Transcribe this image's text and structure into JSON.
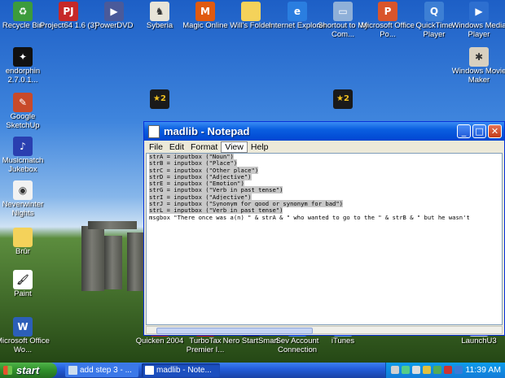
{
  "desktop": {
    "icons": [
      {
        "label": "Recycle Bin",
        "icon": "recycle-bin-icon",
        "color": "#3c9b3c",
        "glyph": "♻"
      },
      {
        "label": "Project64 1.6 (3)",
        "icon": "project64-icon",
        "color": "#c62828",
        "glyph": "PJ"
      },
      {
        "label": "PowerDVD",
        "icon": "powerdvd-icon",
        "color": "#4a5a9a",
        "glyph": "▶"
      },
      {
        "label": "Syberia",
        "icon": "syberia-icon",
        "color": "#e8e4d8",
        "glyph": "♞"
      },
      {
        "label": "Magic Online",
        "icon": "magic-online-icon",
        "color": "#e05a10",
        "glyph": "M"
      },
      {
        "label": "Will's Folder",
        "icon": "folder-icon",
        "color": "#f4d25a",
        "glyph": ""
      },
      {
        "label": "Internet Explorer",
        "icon": "internet-explorer-icon",
        "color": "#2a7ee0",
        "glyph": "e"
      },
      {
        "label": "Shortout to My Com...",
        "icon": "my-computer-icon",
        "color": "#8fb0d8",
        "glyph": "▭"
      },
      {
        "label": "Microsoft Office Po...",
        "icon": "powerpoint-icon",
        "color": "#d9552b",
        "glyph": "P"
      },
      {
        "label": "QuickTime Player",
        "icon": "quicktime-icon",
        "color": "#3d7fd4",
        "glyph": "Q"
      },
      {
        "label": "Windows Media Player",
        "icon": "media-player-icon",
        "color": "#2d6fd0",
        "glyph": "▶"
      },
      {
        "label": "endorphin 2.7.0.1...",
        "icon": "endorphin-icon",
        "color": "#111111",
        "glyph": "✦"
      },
      {
        "label": "Windows Movie Maker",
        "icon": "movie-maker-icon",
        "color": "#d8d0c0",
        "glyph": "✱"
      },
      {
        "label": "Google SketchUp",
        "icon": "sketchup-icon",
        "color": "#c84a2a",
        "glyph": "✎"
      },
      {
        "label": "Musicmatch Jukebox",
        "icon": "musicmatch-icon",
        "color": "#2a3fb0",
        "glyph": "♪"
      },
      {
        "label": "Neverwinter Nights",
        "icon": "neverwinter-icon",
        "color": "#f2f2f2",
        "glyph": "◉"
      },
      {
        "label": "Brûr",
        "icon": "folder-icon",
        "color": "#f4d25a",
        "glyph": ""
      },
      {
        "label": "Paint",
        "icon": "paint-icon",
        "color": "#ffffff",
        "glyph": "🖌"
      },
      {
        "label": "Microsoft Office Wo...",
        "icon": "word-icon",
        "color": "#2c5fb8",
        "glyph": "W"
      },
      {
        "label": "Quicken 2004",
        "icon": "quicken-icon",
        "color": "#b0282a",
        "glyph": "Q"
      },
      {
        "label": "TurboTax Premier I...",
        "icon": "turbotax-icon",
        "color": "#c21c1c",
        "glyph": "T"
      },
      {
        "label": "Nero StartSmart",
        "icon": "nero-icon",
        "color": "#222222",
        "glyph": "N"
      },
      {
        "label": "Sev Account Connection",
        "icon": "account-connection-icon",
        "color": "#4b8bd8",
        "glyph": "S"
      },
      {
        "label": "iTunes",
        "icon": "itunes-icon",
        "color": "#6ea6e0",
        "glyph": "♫"
      },
      {
        "label": "LaunchU3",
        "icon": "launchu3-icon",
        "color": "#d0d8e8",
        "glyph": "U3"
      }
    ],
    "partial_icons": [
      {
        "label": "",
        "icon": "starcraft-icon",
        "color": "#1a1a1a",
        "glyph": "★2"
      },
      {
        "label": "",
        "icon": "starcraft-icon",
        "color": "#1a1a1a",
        "glyph": "★2"
      }
    ]
  },
  "notepad": {
    "title": "madlib - Notepad",
    "menu": [
      "File",
      "Edit",
      "Format",
      "View",
      "Help"
    ],
    "selected_menu_index": 3,
    "lines": [
      "strA = inputbox (\"Noun\")",
      "strB = inputbox (\"Place\")",
      "strC = inputbox (\"Other place\")",
      "strD = inputbox (\"Adjective\")",
      "strE = inputbox (\"Emotion\")",
      "strG = inputbox (\"Verb in past tense\")",
      "strI = inputbox (\"Adjective\")",
      "strJ = inputbox (\"Synonym for good or synonym for bad\")",
      "strL = inputbox (\"Verb in past tense\")",
      "msgbox \"There once was a(n) \" & strA & \" who wanted to go to the \" & strB & \" but he wasn't"
    ],
    "selected_line_count": 9,
    "buttons": {
      "minimize": "_",
      "maximize": "□",
      "close": "✕"
    }
  },
  "taskbar": {
    "start_label": "start",
    "tasks": [
      {
        "label": "add step 3 - ..."
      },
      {
        "label": "madlib - Note..."
      }
    ],
    "clock": "11:39 AM"
  }
}
